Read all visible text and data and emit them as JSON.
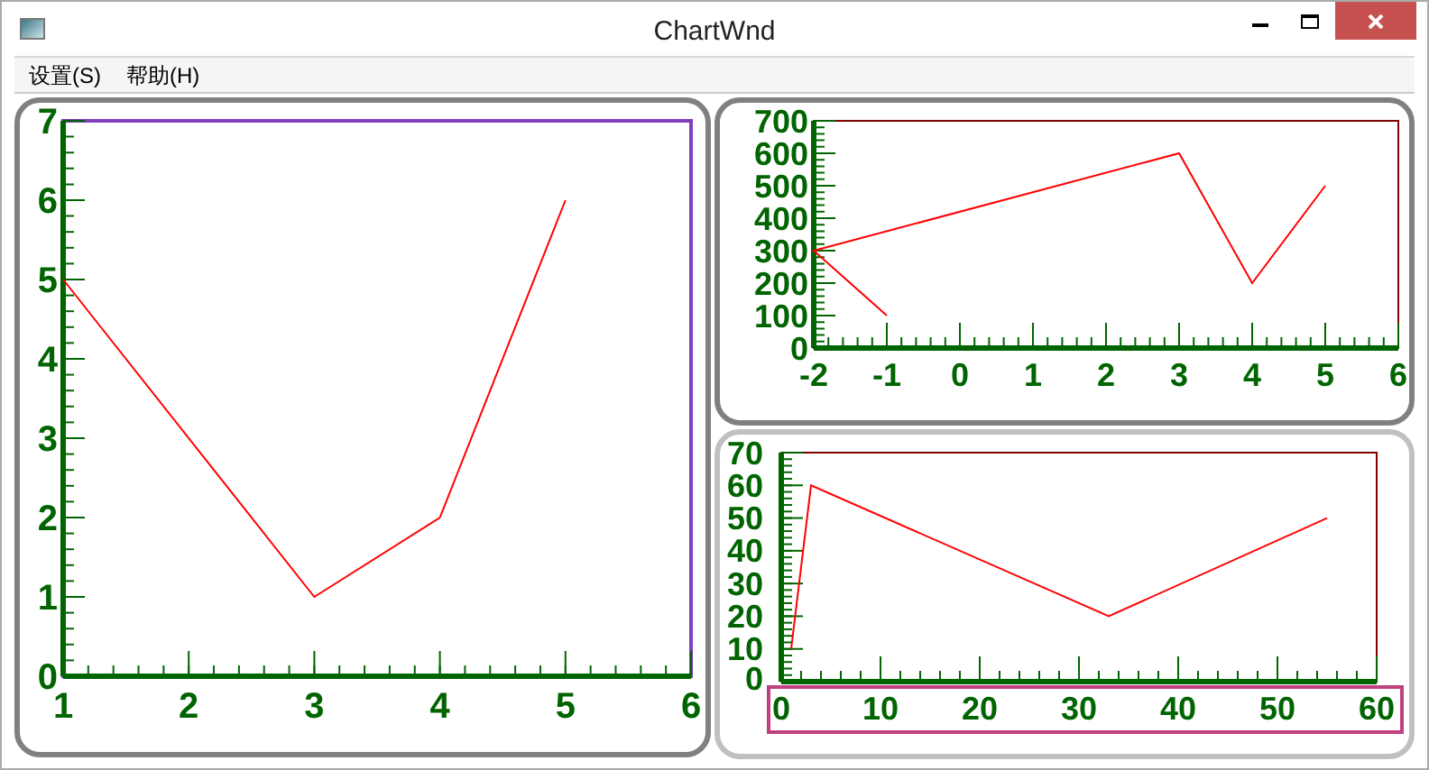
{
  "window": {
    "title": "ChartWnd"
  },
  "menu": [
    {
      "label": "设置(S)"
    },
    {
      "label": "帮助(H)"
    }
  ],
  "charts": [
    {
      "color": "#8040c0",
      "chart_data": {
        "type": "line",
        "x": [
          1,
          3,
          4,
          5
        ],
        "series": [
          {
            "color": "#ff0000",
            "values": [
              5,
              1,
              2,
              6
            ]
          }
        ],
        "xlim": [
          1,
          6
        ],
        "ylim": [
          0,
          7
        ],
        "xticks": [
          1,
          2,
          3,
          4,
          5,
          6
        ],
        "yticks": [
          0,
          1,
          2,
          3,
          4,
          5,
          6,
          7
        ]
      }
    },
    {
      "color": "#800000",
      "chart_data": {
        "type": "line",
        "x": [
          -1,
          -2,
          3,
          4,
          5
        ],
        "series": [
          {
            "color": "#ff0000",
            "values": [
              100,
              300,
              600,
              200,
              500
            ]
          }
        ],
        "xlim": [
          -2,
          6
        ],
        "ylim": [
          0,
          700
        ],
        "xticks": [
          -2,
          -1,
          0,
          1,
          2,
          3,
          4,
          5,
          6
        ],
        "yticks": [
          0,
          100,
          200,
          300,
          400,
          500,
          600,
          700
        ]
      }
    },
    {
      "color": "#800000",
      "chart_data": {
        "type": "line",
        "x": [
          1,
          3,
          33,
          55
        ],
        "series": [
          {
            "color": "#ff0000",
            "values": [
              10,
              60,
              20,
              50
            ]
          }
        ],
        "xlim": [
          0,
          60
        ],
        "ylim": [
          0,
          70
        ],
        "xticks": [
          0,
          10,
          20,
          30,
          40,
          50,
          60
        ],
        "yticks": [
          0,
          10,
          20,
          30,
          40,
          50,
          60,
          70
        ]
      }
    }
  ]
}
